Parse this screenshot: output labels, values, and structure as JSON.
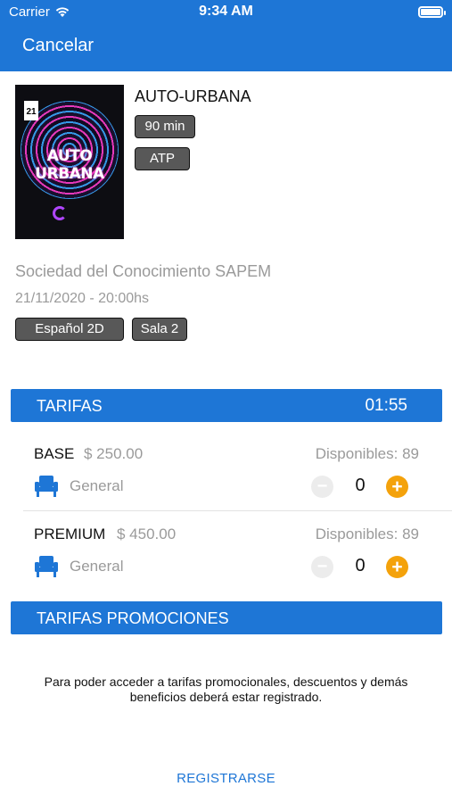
{
  "status_bar": {
    "carrier": "Carrier",
    "time": "9:34 AM",
    "wifi_icon": "wifi-icon",
    "battery_icon": "battery-icon"
  },
  "nav": {
    "cancel_label": "Cancelar"
  },
  "movie": {
    "poster_title": "AUTO URBANA",
    "poster_day": "21",
    "title": "AUTO-URBANA",
    "duration": "90 min",
    "rating": "ATP",
    "venue": "Sociedad del Conocimiento SAPEM",
    "datetime": "21/11/2020 - 20:00hs",
    "language": "Español 2D",
    "room": "Sala 2"
  },
  "tarifas": {
    "header": "TARIFAS",
    "timer": "01:55",
    "items": [
      {
        "name": "BASE",
        "price": "$ 250.00",
        "available": "Disponibles: 89",
        "seat_type": "General",
        "quantity": "0",
        "minus_icon": "minus-icon",
        "plus_icon": "plus-icon",
        "seat_icon": "armchair-icon"
      },
      {
        "name": "PREMIUM",
        "price": "$ 450.00",
        "available": "Disponibles: 89",
        "seat_type": "General",
        "quantity": "0",
        "minus_icon": "minus-icon",
        "plus_icon": "plus-icon",
        "seat_icon": "armchair-icon"
      }
    ]
  },
  "promociones": {
    "header": "TARIFAS PROMOCIONES",
    "message": "Para poder acceder a tarifas promocionales, descuentos y demás beneficios deberá estar registrado.",
    "register_label": "REGISTRARSE"
  },
  "colors": {
    "accent": "#1e76d6",
    "plus": "#f4a20b",
    "muted": "#9a9a9a",
    "chip": "#585858"
  }
}
